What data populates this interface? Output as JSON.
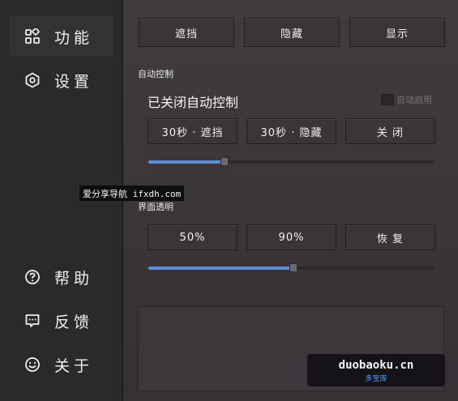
{
  "sidebar": {
    "top_items": [
      {
        "label": "功能",
        "icon": "grid-icon",
        "active": true
      },
      {
        "label": "设置",
        "icon": "hexagon-settings-icon",
        "active": false
      }
    ],
    "bottom_items": [
      {
        "label": "帮助",
        "icon": "help-icon"
      },
      {
        "label": "反馈",
        "icon": "feedback-icon"
      },
      {
        "label": "关于",
        "icon": "smiley-icon"
      }
    ]
  },
  "top_buttons": [
    "遮挡",
    "隐藏",
    "显示"
  ],
  "auto_control": {
    "section_title": "自动控制",
    "status": "已关闭自动控制",
    "auto_enable_label": "自动启用",
    "auto_enable_checked": false,
    "buttons": [
      "30秒 · 遮挡",
      "30秒 · 隐藏",
      "关 闭"
    ],
    "slider_level": 0.26
  },
  "transparency": {
    "section_title": "界面透明",
    "buttons": [
      "50%",
      "90%",
      "恢 复"
    ],
    "slider_level": 0.5
  },
  "watermark": "爱分享导航 ifxdh.com",
  "logo": {
    "line1": "duobaoku.cn",
    "line2": "多宝库"
  },
  "colors": {
    "accent": "#5b8ed6",
    "background": "#3a3538",
    "sidebar": "#2b2a2b"
  }
}
